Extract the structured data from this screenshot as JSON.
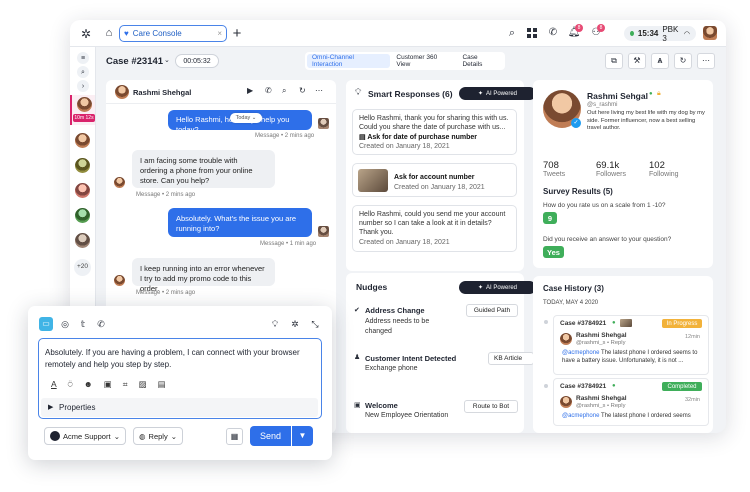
{
  "topbar": {
    "tab_label": "Care Console",
    "notif_count_1": "8",
    "notif_count_2": "8",
    "time": "15:34",
    "user_code": "PBK 3"
  },
  "case": {
    "title": "Case #23141",
    "timer": "00:05:32",
    "view_tabs": [
      "Omni-Channel Interaction",
      "Customer 360 View",
      "Case Details"
    ]
  },
  "rail": {
    "active_time": "10m 12s",
    "more_count": "+20"
  },
  "chat": {
    "contact_name": "Rashmi Shehgal",
    "day_label": "Today",
    "messages": [
      {
        "text": "Hello Rashmi, how may I help you today?",
        "meta": "Message • 2 mins ago"
      },
      {
        "text": "I am facing some trouble with ordering a phone from your online store. Can you help?",
        "meta": "Message • 2 mins ago"
      },
      {
        "text": "Absolutely. What's the issue you are running into?",
        "meta": "Message • 1 min ago"
      },
      {
        "text": "I keep running into an error whenever I try to add my promo code to this order.",
        "meta": "Message • 2 mins ago"
      }
    ]
  },
  "smart": {
    "title": "Smart Responses (6)",
    "ai_label": "AI Powered",
    "cards": [
      {
        "body": "Hello Rashmi, thank you for sharing this with us. Could you share the date of purchase with us...",
        "heading": "Ask for date of purchase number",
        "date": "Created on January 18, 2021"
      },
      {
        "heading": "Ask for account number",
        "date": "Created on January 18, 2021"
      },
      {
        "body": "Hello Rashmi, could you send me your account number so I can take a look at it in details? Thank you.",
        "date": "Created on January 18, 2021"
      }
    ]
  },
  "nudges": {
    "title": "Nudges",
    "ai_label": "AI Powered",
    "items": [
      {
        "title": "Address Change",
        "desc": "Address needs to be changed",
        "action": "Guided Path"
      },
      {
        "title": "Customer Intent Detected",
        "desc": "Exchange phone",
        "action": "KB Article"
      },
      {
        "title": "Welcome",
        "desc": "New Employee Orientation",
        "action": "Route to Bot"
      }
    ]
  },
  "profile": {
    "name": "Rashmi Sehgal",
    "handle": "@s_rashmi",
    "bio": "Out here living my best life with my dog by my side. Former influencer, now a best selling travel author.",
    "tweets": "708",
    "tweets_label": "Tweets",
    "followers": "69.1k",
    "followers_label": "Followers",
    "following": "102",
    "following_label": "Following"
  },
  "survey": {
    "title": "Survey Results (5)",
    "q1": "How do you rate us on a scale from 1 -10?",
    "a1": "9",
    "q2": "Did you receive an answer to your question?",
    "a2": "Yes"
  },
  "history": {
    "title": "Case History (3)",
    "date": "TODAY, MAY 4 2020",
    "cases": [
      {
        "id": "Case #3784921",
        "status": "In Progress",
        "status_color": "#f2b23a",
        "author": "Rashmi Shehgal",
        "handle": "@rashmi_s • Reply",
        "time": "12min",
        "mention": "@acmephone",
        "text": "The latest phone I ordered seems to have a battery issue. Unfortunately, it is not ..."
      },
      {
        "id": "Case #3784921",
        "status": "Completed",
        "status_color": "#3fae5a",
        "author": "Rashmi Shehgal",
        "handle": "@rashmi_s • Reply",
        "time": "32min",
        "mention": "@acmephone",
        "text": "The latest phone I ordered seems"
      }
    ]
  },
  "composer": {
    "text": "Absolutely. If you are having a problem, I can connect with your browser remotely and help you step by step.",
    "properties_label": "Properties",
    "account_label": "Acme Support",
    "mode_label": "Reply",
    "send_label": "Send"
  },
  "colors": {
    "accent": "#2e6fe9",
    "success": "#3fae5a",
    "warning": "#f2b23a",
    "dark": "#1e2230"
  }
}
